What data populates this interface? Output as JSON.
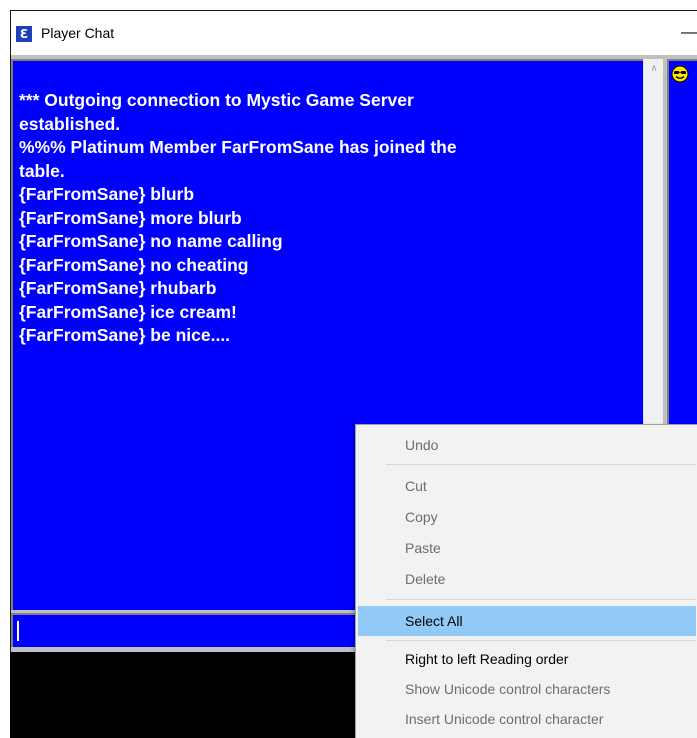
{
  "window": {
    "title": "Player Chat",
    "minimize_label": "—"
  },
  "chat": {
    "lines": [
      "*** Outgoing connection to Mystic Game Server",
      "established.",
      "%%% Platinum Member FarFromSane has joined the",
      "table.",
      "{FarFromSane} blurb",
      "{FarFromSane} more blurb",
      "{FarFromSane} no name calling",
      "{FarFromSane} no cheating",
      "{FarFromSane} rhubarb",
      "{FarFromSane} ice cream!",
      "{FarFromSane} be nice...."
    ],
    "input_value": ""
  },
  "context_menu": {
    "undo": "Undo",
    "cut": "Cut",
    "copy": "Copy",
    "paste": "Paste",
    "delete": "Delete",
    "select_all": "Select All",
    "rtl": "Right to left Reading order",
    "show_unicode": "Show Unicode control characters",
    "insert_unicode": "Insert Unicode control character"
  },
  "colors": {
    "chat_background": "#0000ff",
    "chat_text": "#ffffff",
    "menu_highlight": "#91c9f7"
  }
}
